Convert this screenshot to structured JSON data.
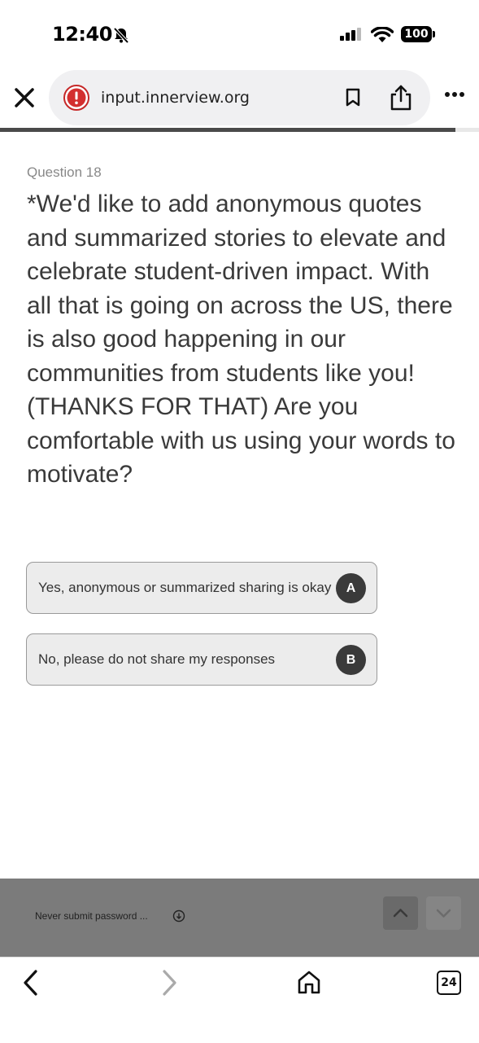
{
  "status_bar": {
    "time": "12:40",
    "battery": "100"
  },
  "browser": {
    "url": "input.innerview.org",
    "tab_count": "24",
    "page_progress_fraction": 0.95
  },
  "question": {
    "number_label": "Question 18",
    "text": "*We'd like to add anonymous quotes and summarized stories to elevate and celebrate student-driven impact. With all that is going on across the US, there is also good happening in our communities from students like you! (THANKS FOR THAT) Are you comfortable with us using your words to motivate?"
  },
  "choices": [
    {
      "label": "Yes, anonymous or summarized sharing is okay",
      "key": "A"
    },
    {
      "label": "No, please do not share my responses",
      "key": "B"
    }
  ],
  "footer": {
    "note": "Never submit password ..."
  },
  "colors": {
    "accent_dark": "#3a3a3a",
    "warning_red": "#d32f2f",
    "footer_bg": "#7b7b7b"
  }
}
